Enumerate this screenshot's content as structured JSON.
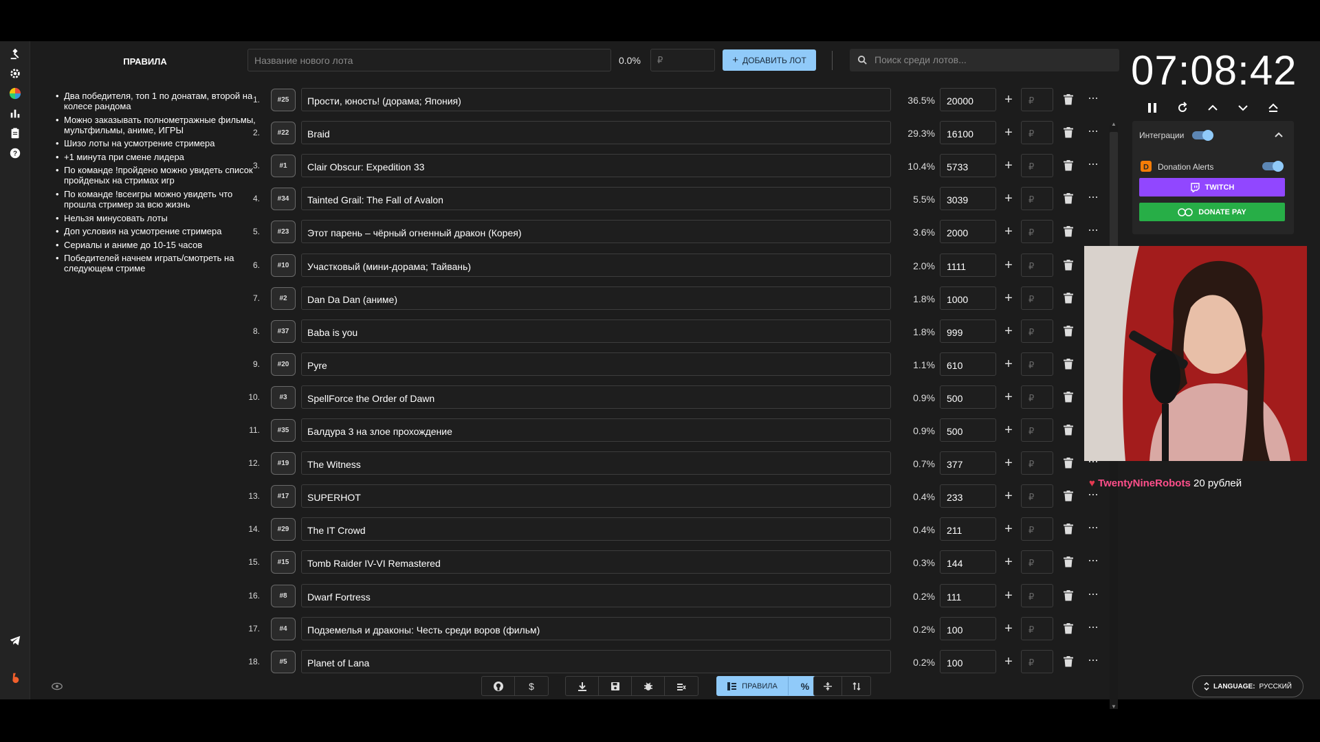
{
  "rules": {
    "title": "ПРАВИЛА",
    "items": [
      "Два победителя, топ 1 по донатам, второй на колесе рандома",
      "Можно заказывать полнометражные фильмы, мультфильмы, аниме, ИГРЫ",
      "Шизо лоты на усмотрение стримера",
      "+1 минута при смене лидера",
      "По команде !пройдено можно увидеть список пройденых на стримах игр",
      "По команде !всеигры можно увидеть что прошла стример за всю жизнь",
      "Нельзя минусовать лоты",
      "Доп условия на усмотрение стримера",
      "Сериалы и аниме до 10-15 часов",
      "Победителей начнем играть/смотреть на следующем стриме"
    ]
  },
  "topbar": {
    "new_lot_placeholder": "Название нового лота",
    "new_percent": "0.0%",
    "currency_placeholder": "₽",
    "add_button": "ДОБАВИТЬ ЛОТ",
    "search_placeholder": "Поиск среди лотов..."
  },
  "lots": [
    {
      "n": "1.",
      "id": "#25",
      "name": "Прости, юность! (дорама; Япония)",
      "pct": "36.5%",
      "amount": "20000"
    },
    {
      "n": "2.",
      "id": "#22",
      "name": "Braid",
      "pct": "29.3%",
      "amount": "16100"
    },
    {
      "n": "3.",
      "id": "#1",
      "name": "Clair Obscur: Expedition 33",
      "pct": "10.4%",
      "amount": "5733"
    },
    {
      "n": "4.",
      "id": "#34",
      "name": "Tainted Grail: The Fall of Avalon",
      "pct": "5.5%",
      "amount": "3039"
    },
    {
      "n": "5.",
      "id": "#23",
      "name": "Этот парень – чёрный огненный дракон (Корея)",
      "pct": "3.6%",
      "amount": "2000"
    },
    {
      "n": "6.",
      "id": "#10",
      "name": "Участковый (мини-дорама; Тайвань)",
      "pct": "2.0%",
      "amount": "1111"
    },
    {
      "n": "7.",
      "id": "#2",
      "name": "Dan Da Dan (аниме)",
      "pct": "1.8%",
      "amount": "1000"
    },
    {
      "n": "8.",
      "id": "#37",
      "name": "Baba is you",
      "pct": "1.8%",
      "amount": "999"
    },
    {
      "n": "9.",
      "id": "#20",
      "name": "Pyre",
      "pct": "1.1%",
      "amount": "610"
    },
    {
      "n": "10.",
      "id": "#3",
      "name": "SpellForce the Order of Dawn",
      "pct": "0.9%",
      "amount": "500"
    },
    {
      "n": "11.",
      "id": "#35",
      "name": "Балдура 3 на злое прохождение",
      "pct": "0.9%",
      "amount": "500"
    },
    {
      "n": "12.",
      "id": "#19",
      "name": "The Witness",
      "pct": "0.7%",
      "amount": "377"
    },
    {
      "n": "13.",
      "id": "#17",
      "name": "SUPERHOT",
      "pct": "0.4%",
      "amount": "233"
    },
    {
      "n": "14.",
      "id": "#29",
      "name": "The IT Crowd",
      "pct": "0.4%",
      "amount": "211"
    },
    {
      "n": "15.",
      "id": "#15",
      "name": "Tomb Raider IV-VI Remastered",
      "pct": "0.3%",
      "amount": "144"
    },
    {
      "n": "16.",
      "id": "#8",
      "name": "Dwarf Fortress",
      "pct": "0.2%",
      "amount": "111"
    },
    {
      "n": "17.",
      "id": "#4",
      "name": "Подземелья и драконы: Честь среди воров (фильм)",
      "pct": "0.2%",
      "amount": "100"
    },
    {
      "n": "18.",
      "id": "#5",
      "name": "Planet of Lana",
      "pct": "0.2%",
      "amount": "100"
    }
  ],
  "row_currency": "₽",
  "timer": "07:08:42",
  "integrations": {
    "title": "Интеграции",
    "donation_alerts": "Donation Alerts",
    "twitch": "TWITCH",
    "donatepay": "DONATE PAY"
  },
  "donation": {
    "name": "TwentyNineRobots",
    "amount": "20 рублей"
  },
  "toolbar": {
    "rules_label": "ПРАВИЛА",
    "percent_symbol": "%",
    "dollar_symbol": "$"
  },
  "language": {
    "prefix": "LANGUAGE:",
    "value": "РУССКИЙ"
  },
  "colors": {
    "accent": "#90caf9",
    "twitch": "#9147ff",
    "donatepay": "#27ae47",
    "donor": "#ff4f8b"
  }
}
